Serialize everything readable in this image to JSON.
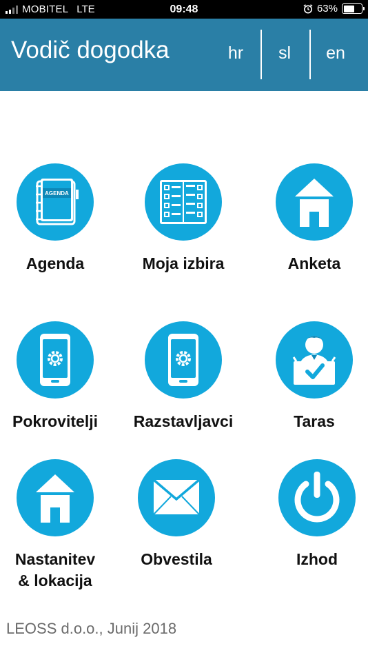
{
  "status_bar": {
    "carrier": "MOBITEL",
    "network": "LTE",
    "time": "09:48",
    "battery": "63%",
    "battery_level": 0.63
  },
  "header": {
    "title": "Vodič dogodka",
    "languages": [
      "hr",
      "sl",
      "en"
    ],
    "background": "#2a7fa6"
  },
  "menu": {
    "accent": "#12a8dc",
    "items": [
      {
        "label": "Agenda",
        "icon": "agenda-book-icon"
      },
      {
        "label": "Moja izbira",
        "icon": "schedule-book-icon"
      },
      {
        "label": "Anketa",
        "icon": "house-icon"
      },
      {
        "label": "Pokrovitelji",
        "icon": "smartphone-gear-icon"
      },
      {
        "label": "Razstavljavci",
        "icon": "smartphone-gear-icon"
      },
      {
        "label": "Taras",
        "icon": "person-check-icon"
      },
      {
        "label": "Nastanitev\n& lokacija",
        "icon": "house-icon"
      },
      {
        "label": "Obvestila",
        "icon": "envelope-icon"
      },
      {
        "label": "Izhod",
        "icon": "power-icon"
      }
    ],
    "agenda_cover_text": "AGENDA"
  },
  "footer": {
    "text": "LEOSS d.o.o., Junij 2018"
  }
}
